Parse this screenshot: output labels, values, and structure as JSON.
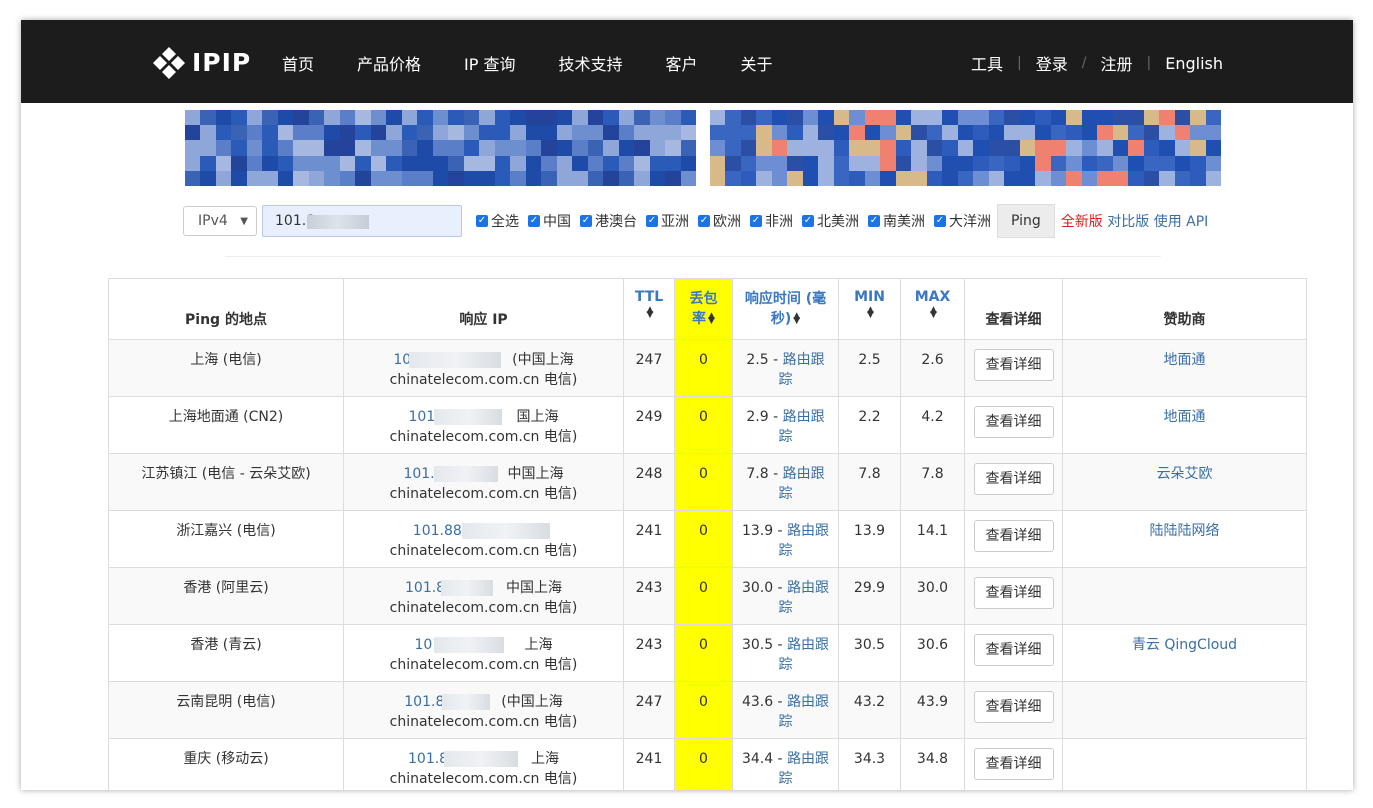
{
  "header": {
    "logo_text": "IPIP",
    "nav": [
      "首页",
      "产品价格",
      "IP 查询",
      "技术支持",
      "客户",
      "关于"
    ],
    "right": [
      "工具",
      "登录",
      "注册",
      "English"
    ]
  },
  "search": {
    "ip_version": "IPv4",
    "ip_value": "101.8",
    "checkboxes": [
      "全选",
      "中国",
      "港澳台",
      "亚洲",
      "欧洲",
      "非洲",
      "北美洲",
      "南美洲",
      "大洋洲"
    ],
    "ping_button": "Ping",
    "link_new": "全新版",
    "link_compare": "对比版",
    "link_api": "使用 API"
  },
  "table": {
    "headers": {
      "location": "Ping 的地点",
      "ip": "响应 IP",
      "ttl": "TTL",
      "loss_1": "丢包",
      "loss_2": "率",
      "time_1": "响应时间 (毫",
      "time_2": "秒)",
      "min": "MIN",
      "max": "MAX",
      "detail": "查看详细",
      "sponsor": "赞助商"
    },
    "rows": [
      {
        "location": "上海 (电信)",
        "ip_prefix": "101",
        "ip_suffix": "(中国上海",
        "domain": "chinatelecom.com.cn 电信)",
        "ttl": "247",
        "loss": "0",
        "time": "2.5",
        "route_1": "路由跟",
        "route_2": "踪",
        "min": "2.5",
        "max": "2.6",
        "detail": "查看详细",
        "sponsor": "地面通"
      },
      {
        "location": "上海地面通 (CN2)",
        "ip_prefix": "101.8",
        "ip_suffix": "国上海",
        "domain": "chinatelecom.com.cn 电信)",
        "ttl": "249",
        "loss": "0",
        "time": "2.9",
        "route_1": "路由跟",
        "route_2": "踪",
        "min": "2.2",
        "max": "4.2",
        "detail": "查看详细",
        "sponsor": "地面通"
      },
      {
        "location": "江苏镇江 (电信 - 云朵艾欧)",
        "ip_prefix": "101.8",
        "ip_suffix": "中国上海",
        "domain": "chinatelecom.com.cn 电信)",
        "ttl": "248",
        "loss": "0",
        "time": "7.8",
        "route_1": "路由跟",
        "route_2": "踪",
        "min": "7.8",
        "max": "7.8",
        "detail": "查看详细",
        "sponsor": "云朵艾欧"
      },
      {
        "location": "浙江嘉兴 (电信)",
        "ip_prefix": "101.88.",
        "ip_suffix": "",
        "domain": "chinatelecom.com.cn 电信)",
        "ttl": "241",
        "loss": "0",
        "time": "13.9",
        "route_1": "路由跟",
        "route_2": "踪",
        "min": "13.9",
        "max": "14.1",
        "detail": "查看详细",
        "sponsor": "陆陆陆网络"
      },
      {
        "location": "香港 (阿里云)",
        "ip_prefix": "101.88",
        "ip_suffix": "中国上海",
        "domain": "chinatelecom.com.cn 电信)",
        "ttl": "243",
        "loss": "0",
        "time": "30.0",
        "route_1": "路由跟",
        "route_2": "踪",
        "min": "29.9",
        "max": "30.0",
        "detail": "查看详细",
        "sponsor": ""
      },
      {
        "location": "香港 (青云)",
        "ip_prefix": "101.8",
        "ip_suffix": "上海",
        "domain": "chinatelecom.com.cn 电信)",
        "ttl": "243",
        "loss": "0",
        "time": "30.5",
        "route_1": "路由跟",
        "route_2": "踪",
        "min": "30.5",
        "max": "30.6",
        "detail": "查看详细",
        "sponsor": "青云 QingCloud"
      },
      {
        "location": "云南昆明 (电信)",
        "ip_prefix": "101.88",
        "ip_suffix": "(中国上海",
        "domain": "chinatelecom.com.cn 电信)",
        "ttl": "247",
        "loss": "0",
        "time": "43.6",
        "route_1": "路由跟",
        "route_2": "踪",
        "min": "43.2",
        "max": "43.9",
        "detail": "查看详细",
        "sponsor": ""
      },
      {
        "location": "重庆 (移动云)",
        "ip_prefix": "101.88",
        "ip_suffix": "上海",
        "domain": "chinatelecom.com.cn 电信)",
        "ttl": "241",
        "loss": "0",
        "time": "34.4",
        "route_1": "路由跟",
        "route_2": "踪",
        "min": "34.3",
        "max": "34.8",
        "detail": "查看详细",
        "sponsor": ""
      }
    ]
  },
  "colors": {
    "header_bg": "#1c1c1c",
    "link": "#3a6ea5",
    "highlight": "#ffff00",
    "new_link": "#e01e1e"
  }
}
